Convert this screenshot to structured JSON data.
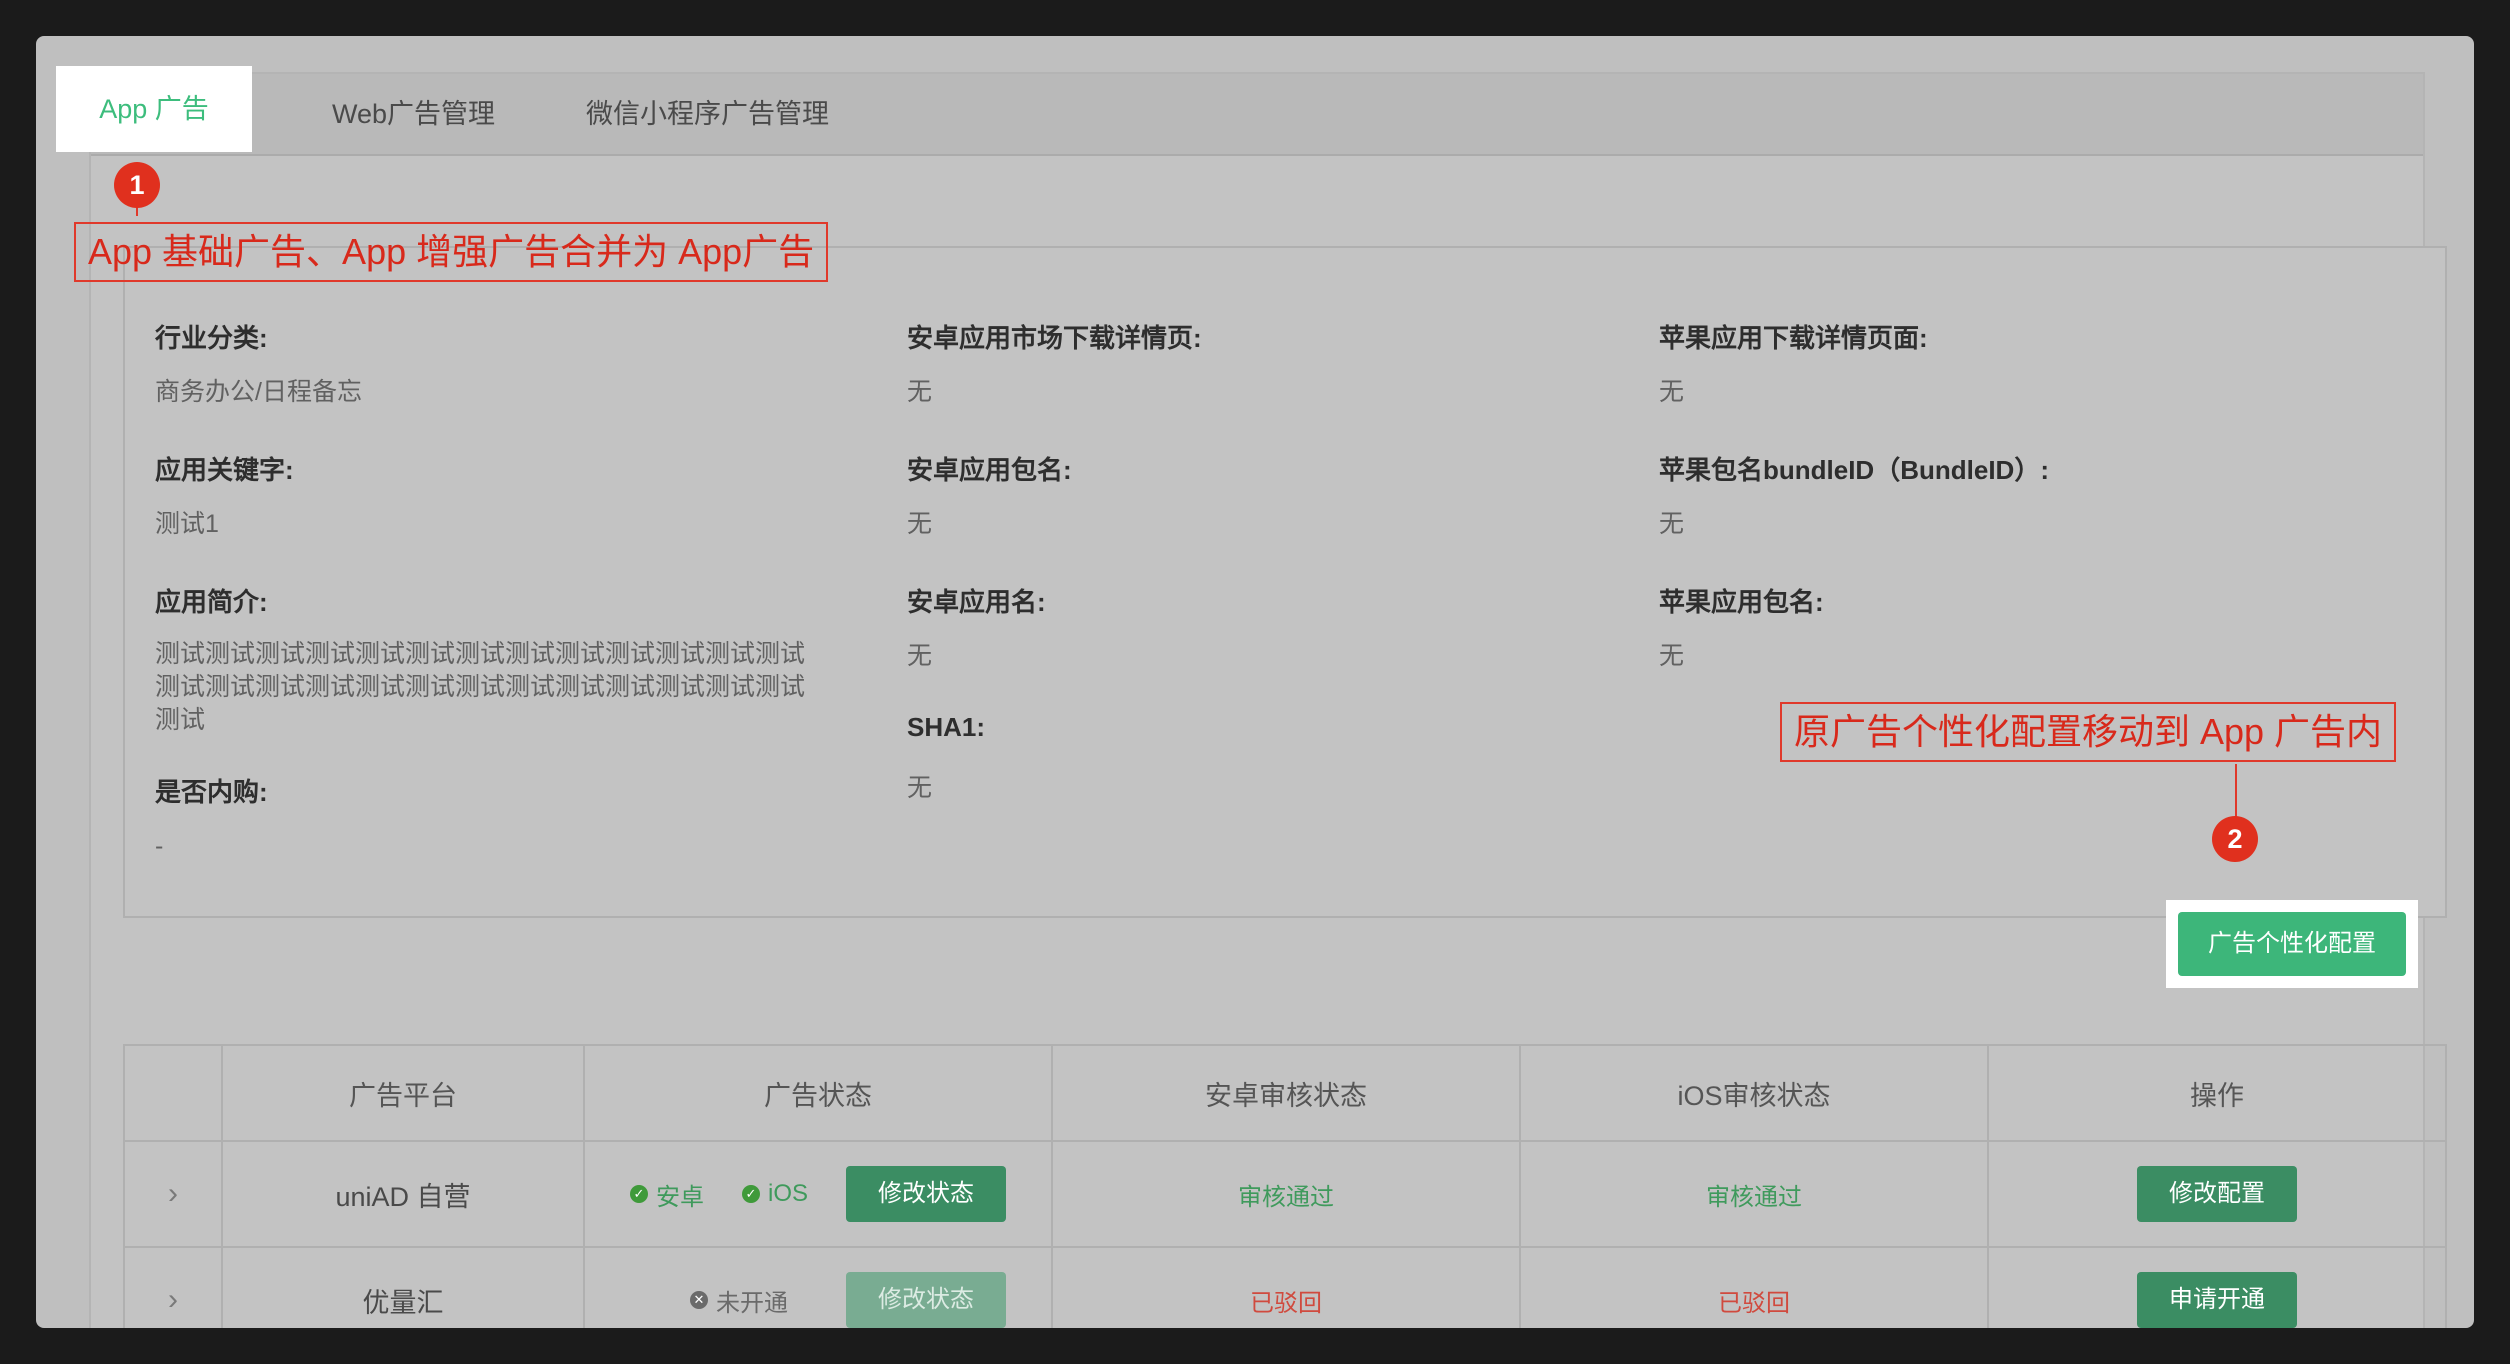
{
  "tabs": [
    {
      "label": "App 广告"
    },
    {
      "label": "Web广告管理"
    },
    {
      "label": "微信小程序广告管理"
    }
  ],
  "annotations": {
    "badge1": "1",
    "badge2": "2",
    "note1": "App 基础广告、App 增强广告合并为 App广告",
    "note2": "原广告个性化配置移动到 App 广告内"
  },
  "info": {
    "industry_label": "行业分类:",
    "industry_value": "商务办公/日程备忘",
    "keywords_label": "应用关键字:",
    "keywords_value": "测试1",
    "intro_label": "应用简介:",
    "intro_value": "测试测试测试测试测试测试测试测试测试测试测试测试测试测试测试测试测试测试测试测试测试测试测试测试测试测试测试",
    "iap_label": "是否内购:",
    "iap_value": "-",
    "android_market_label": "安卓应用市场下载详情页:",
    "android_market_value": "无",
    "android_pkg_label": "安卓应用包名:",
    "android_pkg_value": "无",
    "android_name_label": "安卓应用名:",
    "android_name_value": "无",
    "sha1_label": "SHA1:",
    "sha1_value": "无",
    "apple_download_label": "苹果应用下载详情页面:",
    "apple_download_value": "无",
    "bundle_label": "苹果包名bundleID（BundleID）:",
    "bundle_value": "无",
    "apple_pkg_label": "苹果应用包名:",
    "apple_pkg_value": "无"
  },
  "personalize_button": "广告个性化配置",
  "table": {
    "headers": [
      "广告平台",
      "广告状态",
      "安卓审核状态",
      "iOS审核状态",
      "操作"
    ],
    "rows": [
      {
        "platform": "uniAD 自营",
        "status_android": "安卓",
        "status_ios": "iOS",
        "modify_status": "修改状态",
        "android_review": "审核通过",
        "ios_review": "审核通过",
        "action": "修改配置"
      },
      {
        "platform": "优量汇",
        "status_off": "未开通",
        "modify_status": "修改状态",
        "android_review": "已驳回",
        "ios_review": "已驳回",
        "action": "申请开通"
      }
    ]
  },
  "colors": {
    "accent": "#3dbd7d",
    "annotation_red": "#e0392b",
    "button_green": "#3b8d63"
  }
}
